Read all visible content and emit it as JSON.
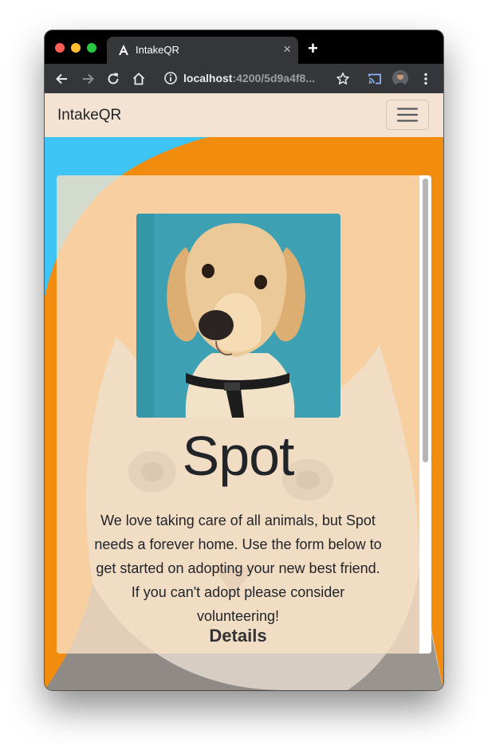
{
  "browser": {
    "tab_title": "IntakeQR",
    "tab_close_glyph": "×",
    "new_tab_glyph": "+",
    "url_host": "localhost",
    "url_path": ":4200/5d9a4f8...",
    "icons": [
      "angular-favicon-icon",
      "back-arrow-icon",
      "forward-arrow-icon",
      "reload-icon",
      "home-icon",
      "info-icon",
      "bookmark-star-icon",
      "cast-icon",
      "profile-avatar",
      "more-vert-icon"
    ]
  },
  "navbar": {
    "brand": "IntakeQR",
    "menu_icon": "hamburger-icon"
  },
  "pet": {
    "name": "Spot",
    "description": "We love taking care of all animals, but Spot needs a forever home. Use the form below to get started on adopting your new best friend. If you can't adopt please consider volunteering!",
    "section_title": "Details"
  },
  "colors": {
    "navbar_bg": "#f4e2d3",
    "orange_bg": "#f28c0f",
    "blue_bg": "#3ec5f5",
    "card_bg": "#f8e0c4",
    "photo_bg": "#3ea1b3"
  }
}
